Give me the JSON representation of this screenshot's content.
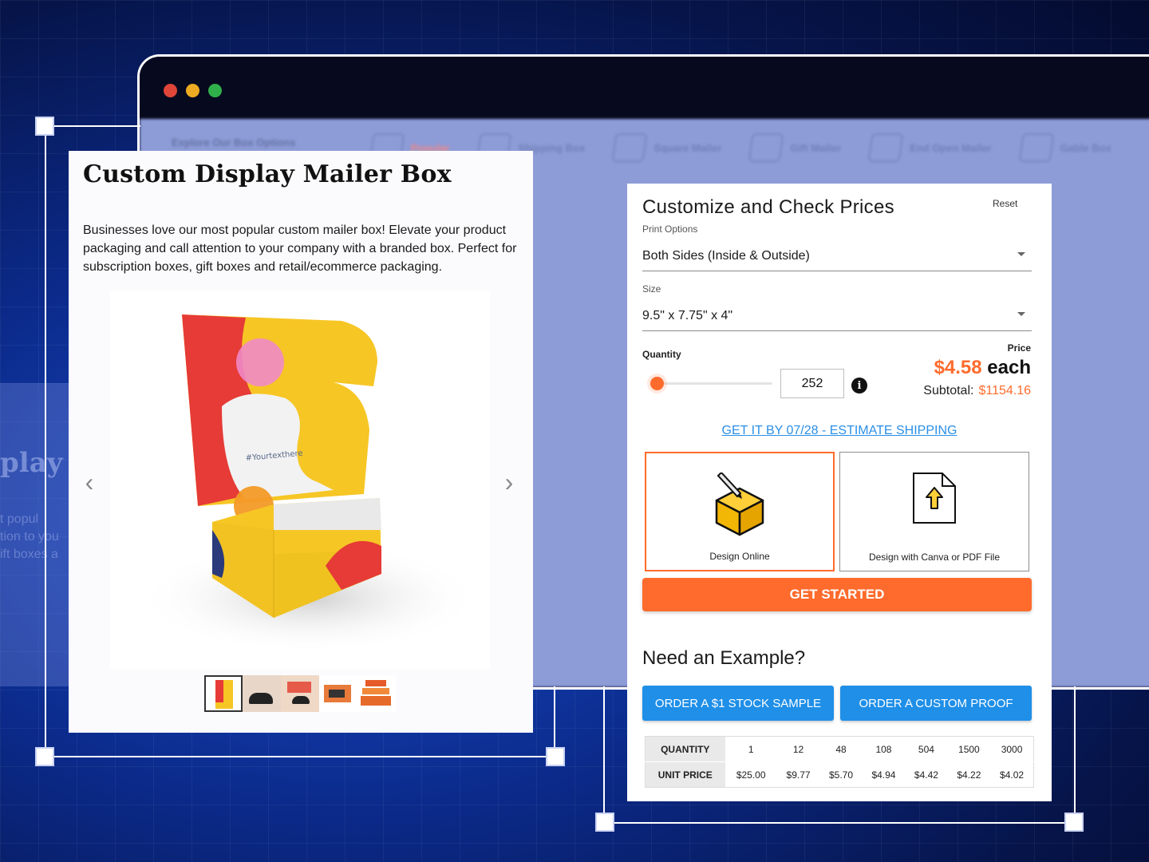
{
  "background_page": {
    "nav_title": "Explore Our Box Options",
    "tabs": [
      "Popular",
      "Shipping Box",
      "Square Mailer",
      "Gift Mailer",
      "End Open Mailer",
      "Gable Box"
    ]
  },
  "product": {
    "title": "Custom Display Mailer Box",
    "description": "Businesses love our most popular custom mailer box! Elevate your product packaging and call attention to your company with a branded box. Perfect for subscription boxes, gift boxes and retail/ecommerce packaging.",
    "image_text": "#Yourtexthere",
    "thumbnail_count": 5
  },
  "config": {
    "title": "Customize and Check Prices",
    "reset_label": "Reset",
    "print_options_label": "Print Options",
    "print_options_value": "Both Sides (Inside & Outside)",
    "size_label": "Size",
    "size_value": "9.5\" x 7.75\" x 4\"",
    "quantity_label": "Quantity",
    "quantity_value": "252",
    "quantity_slider_fraction": 0.05,
    "info_icon": "i",
    "price_label": "Price",
    "price_amount": "$4.58",
    "price_unit": " each",
    "subtotal_label": "Subtotal:",
    "subtotal_value": "$1154.16",
    "shipping_link": "GET IT BY 07/28 - ESTIMATE SHIPPING",
    "design_online_label": "Design Online",
    "design_file_label": "Design with Canva or PDF File",
    "get_started_label": "GET STARTED"
  },
  "example": {
    "title": "Need an Example?",
    "stock_sample_label": "ORDER A $1 STOCK SAMPLE",
    "custom_proof_label": "ORDER A CUSTOM PROOF"
  },
  "price_table": {
    "quantity_header": "QUANTITY",
    "unit_price_header": "UNIT PRICE",
    "quantities": [
      "1",
      "12",
      "48",
      "108",
      "504",
      "1500",
      "3000"
    ],
    "unit_prices": [
      "$25.00",
      "$9.77",
      "$5.70",
      "$4.94",
      "$4.42",
      "$4.22",
      "$4.02"
    ]
  },
  "colors": {
    "accent": "#ff6b2c",
    "link": "#2b8fe6",
    "button_blue": "#1f8fe8",
    "background": "#0b2a8a"
  }
}
